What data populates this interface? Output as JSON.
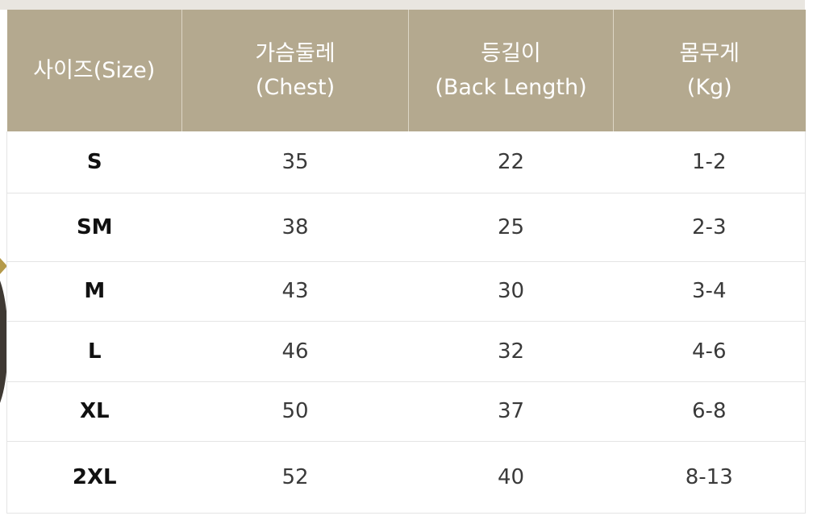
{
  "table": {
    "headers": [
      {
        "line1": "사이즈(Size)",
        "line2": ""
      },
      {
        "line1": "가슴둘레",
        "line2": "(Chest)"
      },
      {
        "line1": "등길이",
        "line2": "(Back Length)"
      },
      {
        "line1": "몸무게",
        "line2": "(Kg)"
      }
    ],
    "rows": [
      {
        "size": "S",
        "chest": "35",
        "back_length": "22",
        "weight": "1-2"
      },
      {
        "size": "SM",
        "chest": "38",
        "back_length": "25",
        "weight": "2-3"
      },
      {
        "size": "M",
        "chest": "43",
        "back_length": "30",
        "weight": "3-4"
      },
      {
        "size": "L",
        "chest": "46",
        "back_length": "32",
        "weight": "4-6"
      },
      {
        "size": "XL",
        "chest": "50",
        "back_length": "37",
        "weight": "6-8"
      },
      {
        "size": "2XL",
        "chest": "52",
        "back_length": "40",
        "weight": "8-13"
      }
    ]
  },
  "colors": {
    "header_background": "#b4a98f",
    "header_text": "#ffffff",
    "top_band": "#e9e6e0",
    "row_divider": "#e4e4e4"
  }
}
